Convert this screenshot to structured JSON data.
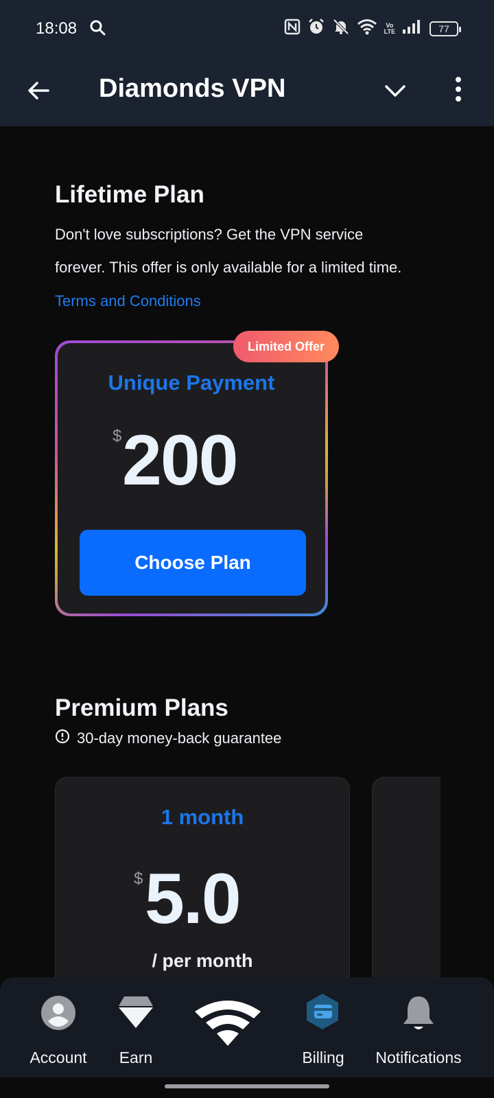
{
  "status_bar": {
    "time": "18:08",
    "battery": "77",
    "volte_top": "Vo",
    "volte_bottom": "LTE",
    "icons": [
      "search-icon",
      "nfc-icon",
      "alarm-icon",
      "mute-icon",
      "wifi-icon",
      "volte-icon",
      "signal-icon",
      "battery-icon"
    ]
  },
  "header": {
    "title": "Diamonds VPN",
    "back_icon": "arrow-left-icon",
    "dropdown_icon": "chevron-down-icon",
    "menu_icon": "more-vertical-icon"
  },
  "lifetime": {
    "title": "Lifetime Plan",
    "description_line1": "Don't love subscriptions? Get the VPN service",
    "description_line2": "forever. This offer is only available for a limited time.",
    "terms_link": "Terms and Conditions",
    "card": {
      "badge": "Limited Offer",
      "name": "Unique Payment",
      "currency": "$",
      "price": "200",
      "button": "Choose Plan"
    }
  },
  "premium": {
    "title": "Premium Plans",
    "guarantee": "30-day money-back guarantee",
    "plans": [
      {
        "name": "1 month",
        "currency": "$",
        "price": "5.0",
        "period": "/ per month"
      }
    ]
  },
  "bottom_nav": {
    "items": [
      {
        "label": "Account",
        "icon": "account-icon",
        "active": false
      },
      {
        "label": "Earn",
        "icon": "diamond-icon",
        "active": false
      },
      {
        "label": "",
        "icon": "vpn-logo-icon",
        "active": false
      },
      {
        "label": "Billing",
        "icon": "billing-icon",
        "active": true
      },
      {
        "label": "Notifications",
        "icon": "bell-icon",
        "active": false
      }
    ]
  },
  "colors": {
    "accent": "#0a6cff",
    "title_blue": "#1b76ea",
    "active_nav": "#47a4e8",
    "header_bg": "#1b2230",
    "badge_start": "#f05a6e",
    "badge_end": "#ff8a5c"
  }
}
